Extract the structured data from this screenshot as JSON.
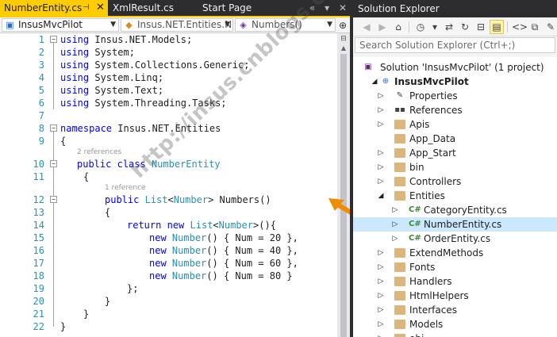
{
  "editor": {
    "tabs": [
      {
        "label": "NumberEntity.cs",
        "active": true
      },
      {
        "label": "XmlResult.cs",
        "active": false
      },
      {
        "label": "Start Page",
        "active": false
      }
    ],
    "navbar": {
      "project": "InsusMvcPilot",
      "type": "Insus.NET.Entities.Nu",
      "member": "Numbers()"
    },
    "references": [
      "2 references",
      "1 reference"
    ],
    "line_numbers": [
      "1",
      "2",
      "3",
      "4",
      "5",
      "6",
      "7",
      "8",
      "9",
      "10",
      "11",
      "12",
      "13",
      "14",
      "15",
      "16",
      "17",
      "18",
      "19",
      "20",
      "21",
      "22"
    ],
    "code": {
      "l1_kw": "using",
      "l1_rest": " Insus.NET.Models;",
      "l2_kw": "using",
      "l2_rest": " System;",
      "l3_kw": "using",
      "l3_rest": " System.Collections.Generic;",
      "l4_kw": "using",
      "l4_rest": " System.Linq;",
      "l5_kw": "using",
      "l5_rest": " System.Text;",
      "l6_kw": "using",
      "l6_rest": " System.Threading.Tasks;",
      "l8_kw": "namespace",
      "l8_rest": " Insus.NET.Entities",
      "l9": "{",
      "l10_kw1": "public",
      "l10_kw2": "class",
      "l10_type": "NumberEntity",
      "l11": "{",
      "l12_kw1": "public",
      "l12_type1": "List",
      "l12_lt": "<",
      "l12_type2": "Number",
      "l12_rest": "> Numbers()",
      "l13": "{",
      "l14_kw1": "return",
      "l14_kw2": "new",
      "l14_type1": "List",
      "l14_lt": "<",
      "l14_type2": "Number",
      "l14_rest": ">(){",
      "l15_kw": "new",
      "l15_type": "Number",
      "l15_rest": "() { Num = 20 },",
      "l16_kw": "new",
      "l16_type": "Number",
      "l16_rest": "() { Num = 40 },",
      "l17_kw": "new",
      "l17_type": "Number",
      "l17_rest": "() { Num = 60 },",
      "l18_kw": "new",
      "l18_type": "Number",
      "l18_rest": "() { Num = 80 }",
      "l19": "};",
      "l20": "}",
      "l21": "}",
      "l22": "}"
    },
    "watermark": "http://insus.cnblogs.com"
  },
  "solution_explorer": {
    "title": "Solution Explorer",
    "search_placeholder": "Search Solution Explorer (Ctrl+;)",
    "solution": "Solution 'InsusMvcPilot' (1 project)",
    "project": "InsusMvcPilot",
    "items": [
      {
        "label": "Properties"
      },
      {
        "label": "References"
      },
      {
        "label": "Apis"
      },
      {
        "label": "App_Data"
      },
      {
        "label": "App_Start"
      },
      {
        "label": "bin"
      },
      {
        "label": "Controllers"
      },
      {
        "label": "Entities"
      },
      {
        "label": "CategoryEntity.cs"
      },
      {
        "label": "NumberEntity.cs"
      },
      {
        "label": "OrderEntity.cs"
      },
      {
        "label": "ExtendMethods"
      },
      {
        "label": "Fonts"
      },
      {
        "label": "Handlers"
      },
      {
        "label": "HtmlHelpers"
      },
      {
        "label": "Interfaces"
      },
      {
        "label": "Models"
      },
      {
        "label": "obj"
      }
    ]
  },
  "colors": {
    "keyword": "#0000ff",
    "type": "#2b91af",
    "active_tab": "#ffcc00",
    "arrow": "#f08c00",
    "selection": "#cce8ff"
  }
}
